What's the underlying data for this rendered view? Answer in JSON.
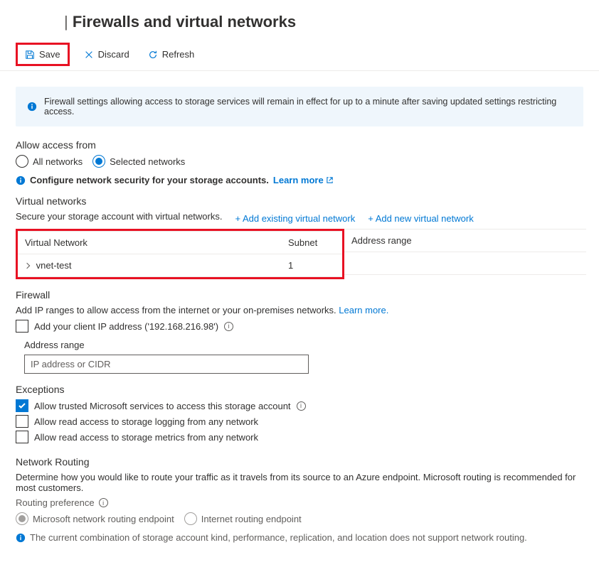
{
  "title": {
    "separator": "|",
    "text": "Firewalls and virtual networks"
  },
  "toolbar": {
    "save": "Save",
    "discard": "Discard",
    "refresh": "Refresh"
  },
  "banner": {
    "text": "Firewall settings allowing access to storage services will remain in effect for up to a minute after saving updated settings restricting access."
  },
  "access": {
    "title": "Allow access from",
    "all": "All networks",
    "selected": "Selected networks",
    "config_prefix": "Configure network security for your storage accounts.",
    "learn_more": "Learn more"
  },
  "vnet": {
    "title": "Virtual networks",
    "desc": "Secure your storage account with virtual networks.",
    "add_existing": "+ Add existing virtual network",
    "add_new": "+ Add new virtual network",
    "col_network": "Virtual Network",
    "col_subnet": "Subnet",
    "col_range": "Address range",
    "row_name": "vnet-test",
    "row_subnet": "1"
  },
  "firewall": {
    "title": "Firewall",
    "desc_prefix": "Add IP ranges to allow access from the internet or your on-premises networks.",
    "learn_more": "Learn more.",
    "add_client_ip": "Add your client IP address ('192.168.216.98')",
    "range_label": "Address range",
    "range_placeholder": "IP address or CIDR"
  },
  "exceptions": {
    "title": "Exceptions",
    "trusted": "Allow trusted Microsoft services to access this storage account",
    "logging": "Allow read access to storage logging from any network",
    "metrics": "Allow read access to storage metrics from any network"
  },
  "routing": {
    "title": "Network Routing",
    "desc": "Determine how you would like to route your traffic as it travels from its source to an Azure endpoint. Microsoft routing is recommended for most customers.",
    "pref_label": "Routing preference",
    "ms_endpoint": "Microsoft network routing endpoint",
    "internet_endpoint": "Internet routing endpoint",
    "warn": "The current combination of storage account kind, performance, replication, and location does not support network routing."
  }
}
